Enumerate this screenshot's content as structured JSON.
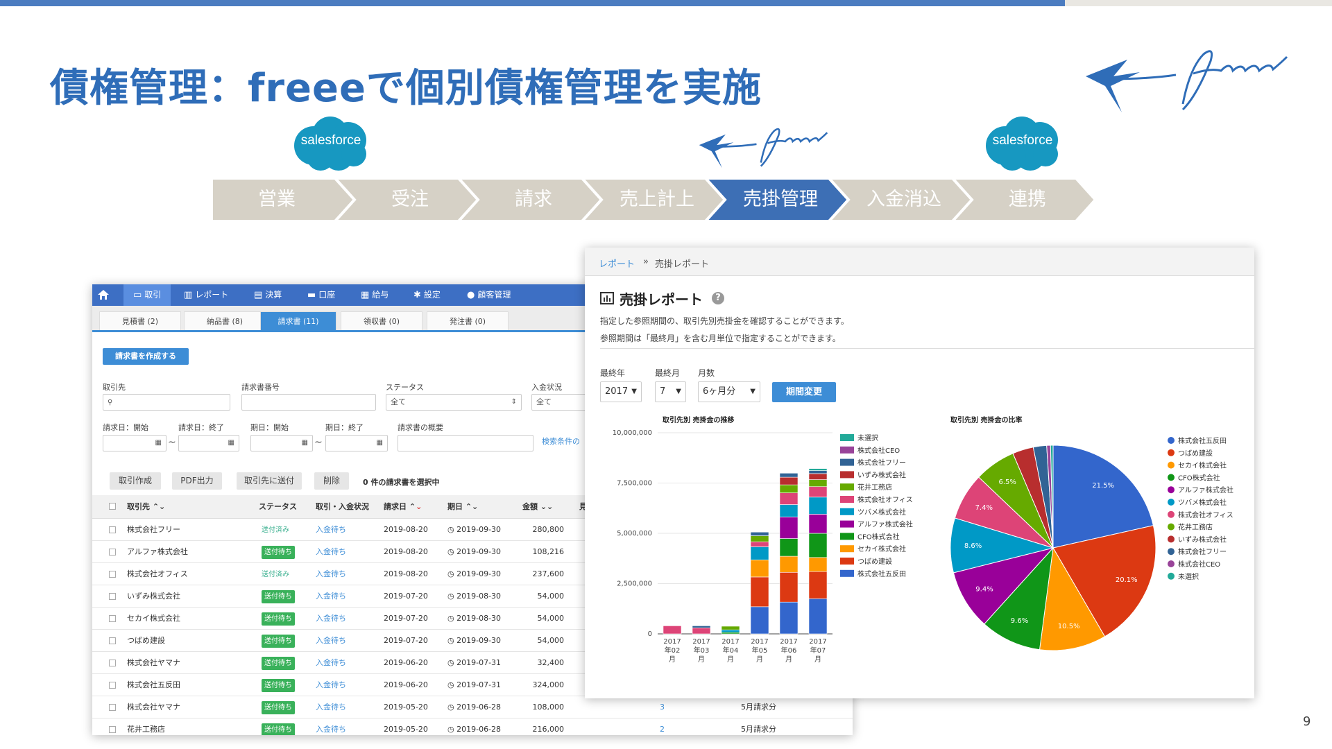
{
  "slide": {
    "title": "債権管理：freeeで個別債権管理を実施",
    "page_number": "9"
  },
  "logos": {
    "salesforce_label": "salesforce"
  },
  "flow": {
    "steps": [
      "営業",
      "受注",
      "請求",
      "売上計上",
      "売掛管理",
      "入金消込",
      "連携"
    ],
    "active": "売掛管理"
  },
  "invoice_app": {
    "nav": [
      "取引",
      "レポート",
      "決算",
      "口座",
      "給与",
      "設定",
      "顧客管理"
    ],
    "subtabs": [
      "見積書 (2)",
      "納品書 (8)",
      "請求書 (11)",
      "領収書 (0)",
      "発注書 (0)"
    ],
    "create_button": "請求書を作成する",
    "filters": {
      "partner": "取引先",
      "invoice_no": "請求書番号",
      "status": "ステータス",
      "status_value": "全て",
      "payment_status": "入金状況",
      "payment_value": "全て",
      "date_start": "請求日：開始",
      "date_end": "請求日：終了",
      "due_start": "期日：開始",
      "due_end": "期日：終了",
      "summary": "請求書の概要",
      "search_link": "検索条件の"
    },
    "actions": [
      "取引作成",
      "PDF出力",
      "取引先に送付",
      "削除"
    ],
    "selected_text": "0 件の請求書を選択中",
    "columns": [
      "取引先",
      "ステータス",
      "取引・入金状況",
      "請求日",
      "期日",
      "金額",
      "見"
    ],
    "rows": [
      {
        "partner": "株式会社フリー",
        "status": "送付済み",
        "payment": "入金待ち",
        "date": "2019-08-20",
        "due": "2019-09-30",
        "amount": "280,800",
        "extra1": "",
        "extra2": ""
      },
      {
        "partner": "アルファ株式会社",
        "status": "送付待ち",
        "payment": "入金待ち",
        "date": "2019-08-20",
        "due": "2019-09-30",
        "amount": "108,216",
        "extra1": "",
        "extra2": ""
      },
      {
        "partner": "株式会社オフィス",
        "status": "送付済み",
        "payment": "入金待ち",
        "date": "2019-08-20",
        "due": "2019-09-30",
        "amount": "237,600",
        "extra1": "",
        "extra2": ""
      },
      {
        "partner": "いずみ株式会社",
        "status": "送付待ち",
        "payment": "入金待ち",
        "date": "2019-07-20",
        "due": "2019-08-30",
        "amount": "54,000",
        "extra1": "",
        "extra2": ""
      },
      {
        "partner": "セカイ株式会社",
        "status": "送付待ち",
        "payment": "入金待ち",
        "date": "2019-07-20",
        "due": "2019-08-30",
        "amount": "54,000",
        "extra1": "",
        "extra2": ""
      },
      {
        "partner": "つばめ建設",
        "status": "送付待ち",
        "payment": "入金待ち",
        "date": "2019-07-20",
        "due": "2019-09-30",
        "amount": "54,000",
        "extra1": "",
        "extra2": ""
      },
      {
        "partner": "株式会社ヤマナ",
        "status": "送付待ち",
        "payment": "入金待ち",
        "date": "2019-06-20",
        "due": "2019-07-31",
        "amount": "32,400",
        "extra1": "",
        "extra2": ""
      },
      {
        "partner": "株式会社五反田",
        "status": "送付待ち",
        "payment": "入金待ち",
        "date": "2019-06-20",
        "due": "2019-07-31",
        "amount": "324,000",
        "extra1": "",
        "extra2": ""
      },
      {
        "partner": "株式会社ヤマナ",
        "status": "送付待ち",
        "payment": "入金待ち",
        "date": "2019-05-20",
        "due": "2019-06-28",
        "amount": "108,000",
        "extra1": "3",
        "extra2": "5月請求分"
      },
      {
        "partner": "花井工務店",
        "status": "送付待ち",
        "payment": "入金待ち",
        "date": "2019-05-20",
        "due": "2019-06-28",
        "amount": "216,000",
        "extra1": "2",
        "extra2": "5月請求分"
      }
    ]
  },
  "report": {
    "breadcrumb_root": "レポート",
    "breadcrumb_sep": "»",
    "breadcrumb_current": "売掛レポート",
    "title": "売掛レポート",
    "desc1": "指定した参照期間の、取引先別売掛金を確認することができます。",
    "desc2": "参照期間は「最終月」を含む月単位で指定することができます。",
    "label_year": "最終年",
    "label_month": "最終月",
    "label_months": "月数",
    "year_value": "2017",
    "month_value": "7",
    "months_value": "6ヶ月分",
    "period_button": "期間変更"
  },
  "chart_data": [
    {
      "type": "bar",
      "stacked": true,
      "title": "取引先別 売掛金の推移",
      "categories": [
        "2017年02月",
        "2017年03月",
        "2017年04月",
        "2017年05月",
        "2017年06月",
        "2017年07月"
      ],
      "ylim": [
        0,
        10000000
      ],
      "yticks": [
        "0",
        "2,500,000",
        "5,000,000",
        "7,500,000",
        "10,000,000"
      ],
      "legend_placement": "right",
      "series": [
        {
          "name": "株式会社五反田",
          "color": "#3366cc",
          "values": [
            0,
            0,
            0,
            1350000,
            1580000,
            1750000
          ]
        },
        {
          "name": "つばめ建設",
          "color": "#dc3912",
          "values": [
            0,
            0,
            0,
            1480000,
            1480000,
            1350000
          ]
        },
        {
          "name": "セカイ株式会社",
          "color": "#ff9900",
          "values": [
            0,
            0,
            0,
            850000,
            800000,
            700000
          ]
        },
        {
          "name": "CFO株式会社",
          "color": "#109618",
          "values": [
            0,
            0,
            80000,
            0,
            880000,
            1200000
          ]
        },
        {
          "name": "アルファ株式会社",
          "color": "#990099",
          "values": [
            0,
            0,
            0,
            0,
            1070000,
            950000
          ]
        },
        {
          "name": "ツバメ株式会社",
          "color": "#0099c6",
          "values": [
            0,
            0,
            120000,
            650000,
            620000,
            850000
          ]
        },
        {
          "name": "株式会社オフィス",
          "color": "#dd4477",
          "values": [
            400000,
            300000,
            0,
            250000,
            580000,
            520000
          ]
        },
        {
          "name": "花井工務店",
          "color": "#66aa00",
          "values": [
            0,
            0,
            180000,
            300000,
            400000,
            350000
          ]
        },
        {
          "name": "いずみ株式会社",
          "color": "#b82e2e",
          "values": [
            0,
            0,
            0,
            0,
            380000,
            300000
          ]
        },
        {
          "name": "株式会社フリー",
          "color": "#316395",
          "values": [
            0,
            100000,
            0,
            180000,
            200000,
            150000
          ]
        },
        {
          "name": "株式会社CEO",
          "color": "#994499",
          "values": [
            0,
            0,
            0,
            0,
            0,
            0
          ]
        },
        {
          "name": "未選択",
          "color": "#22aa99",
          "values": [
            0,
            0,
            0,
            0,
            0,
            100000
          ]
        }
      ]
    },
    {
      "type": "pie",
      "title": "取引先別 売掛金の比率",
      "legend_placement": "right",
      "slices": [
        {
          "name": "株式会社五反田",
          "color": "#3366cc",
          "value": 21.5,
          "label": "21.5%"
        },
        {
          "name": "つばめ建設",
          "color": "#dc3912",
          "value": 20.1,
          "label": "20.1%"
        },
        {
          "name": "セカイ株式会社",
          "color": "#ff9900",
          "value": 10.5,
          "label": "10.5%"
        },
        {
          "name": "CFO株式会社",
          "color": "#109618",
          "value": 9.6,
          "label": "9.6%"
        },
        {
          "name": "アルファ株式会社",
          "color": "#990099",
          "value": 9.4,
          "label": "9.4%"
        },
        {
          "name": "ツバメ株式会社",
          "color": "#0099c6",
          "value": 8.6,
          "label": "8.6%"
        },
        {
          "name": "株式会社オフィス",
          "color": "#dd4477",
          "value": 7.4,
          "label": "7.4%"
        },
        {
          "name": "花井工務店",
          "color": "#66aa00",
          "value": 6.5,
          "label": "6.5%"
        },
        {
          "name": "いずみ株式会社",
          "color": "#b82e2e",
          "value": 3.3,
          "label": ""
        },
        {
          "name": "株式会社フリー",
          "color": "#316395",
          "value": 2.1,
          "label": ""
        },
        {
          "name": "株式会社CEO",
          "color": "#994499",
          "value": 0.6,
          "label": ""
        },
        {
          "name": "未選択",
          "color": "#22aa99",
          "value": 0.4,
          "label": ""
        }
      ]
    }
  ]
}
